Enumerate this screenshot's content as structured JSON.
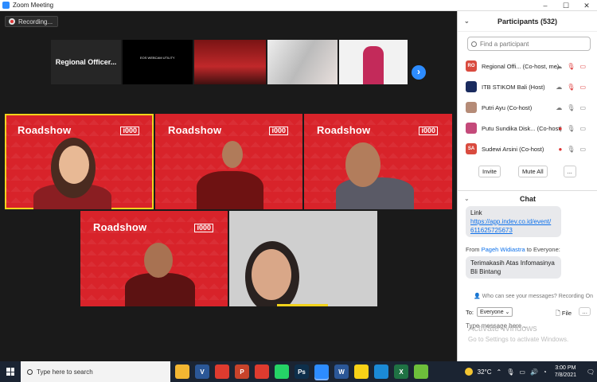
{
  "window": {
    "title": "Zoom Meeting"
  },
  "recording": {
    "label": "Recording..."
  },
  "strip": {
    "name_tile": "Regional Officer...",
    "thumb1_text": "EOS WEBCAM UTILITY",
    "next_icon": "chevron-right-icon"
  },
  "tiles": {
    "roadshow": "Roadshow",
    "logo": "i000"
  },
  "participants": {
    "title": "Participants (532)",
    "search_placeholder": "Find a participant",
    "items": [
      {
        "initials": "RO",
        "name": "Regional Offi...",
        "role": "(Co-host, me)",
        "color": "#d94b3f"
      },
      {
        "initials": "",
        "name": "ITB STIKOM Bali",
        "role": "(Host)",
        "color": "#1a2b5e"
      },
      {
        "initials": "",
        "name": "Putri Ayu",
        "role": "(Co-host)",
        "color": "#b58b77"
      },
      {
        "initials": "",
        "name": "Putu Sundika Disk...",
        "role": "(Co-host)",
        "color": "#c44a7a"
      },
      {
        "initials": "SA",
        "name": "Sudewi Arsini",
        "role": "(Co-host)",
        "color": "#d94b3f"
      }
    ],
    "invite": "Invite",
    "mute_all": "Mute All",
    "more": "..."
  },
  "chat": {
    "title": "Chat",
    "msg1_label": "Link",
    "msg1_link_line1": "https://app.indev.co.id/event/",
    "msg1_link_line2": "611625725673",
    "from_prefix": "From",
    "from_user": "Pageh Widiastra",
    "from_suffix": "to Everyone:",
    "msg2_line1": "Terimakasih Atas Infomasinya",
    "msg2_line2": "Bli Bintang",
    "who_can_see": "Who can see your messages? Recording On",
    "to_label": "To:",
    "to_value": "Everyone",
    "file_label": "File",
    "more": "...",
    "type_placeholder": "Type message here..."
  },
  "watermark": {
    "line1": "Activate Windows",
    "line2": "Go to Settings to activate Windows."
  },
  "taskbar": {
    "search_placeholder": "Type here to search",
    "apps": [
      {
        "name": "file-explorer-icon",
        "label": "",
        "color": "#f2b632"
      },
      {
        "name": "visual-studio-icon",
        "label": "V",
        "color": "#2b5797"
      },
      {
        "name": "chrome-icon",
        "label": "",
        "color": "#de3b2f"
      },
      {
        "name": "powerpoint-icon",
        "label": "P",
        "color": "#c8432b"
      },
      {
        "name": "chrome-icon-2",
        "label": "",
        "color": "#de3b2f"
      },
      {
        "name": "whatsapp-icon",
        "label": "",
        "color": "#25d366"
      },
      {
        "name": "photoshop-icon",
        "label": "Ps",
        "color": "#0e2f4b"
      },
      {
        "name": "zoom-icon",
        "label": "",
        "color": "#2d8cff"
      },
      {
        "name": "word-icon",
        "label": "W",
        "color": "#2b5797"
      },
      {
        "name": "sticky-notes-icon",
        "label": "",
        "color": "#f7d117"
      },
      {
        "name": "edge-icon",
        "label": "",
        "color": "#1b8ad6"
      },
      {
        "name": "excel-icon",
        "label": "X",
        "color": "#1f7244"
      },
      {
        "name": "android-icon",
        "label": "",
        "color": "#6dbf3b"
      }
    ],
    "temperature": "32°C",
    "time": "3:00 PM",
    "date": "7/8/2021"
  }
}
